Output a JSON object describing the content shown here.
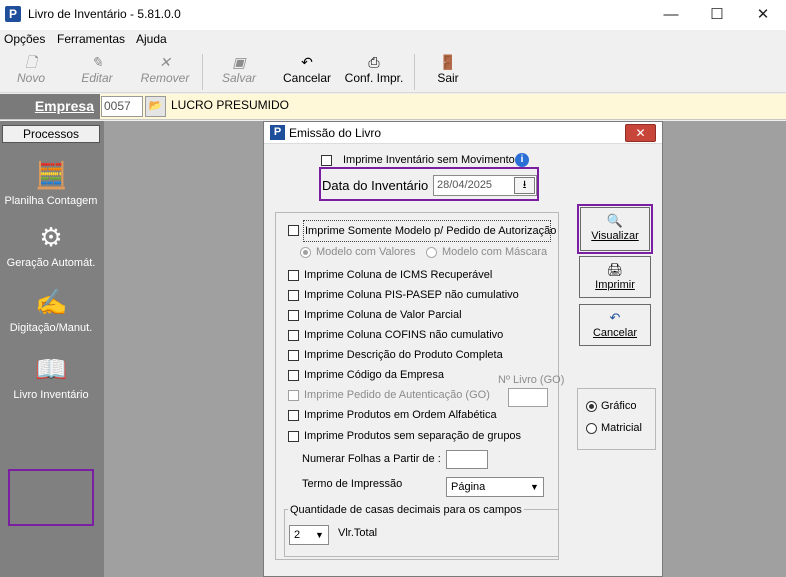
{
  "window": {
    "title": "Livro de Inventário - 5.81.0.0",
    "app_icon": "P",
    "minimize": "—",
    "maximize": "☐",
    "close": "✕"
  },
  "menu": [
    "Opções",
    "Ferramentas",
    "Ajuda"
  ],
  "toolbar": {
    "novo": "Novo",
    "editar": "Editar",
    "remover": "Remover",
    "salvar": "Salvar",
    "cancelar": "Cancelar",
    "conf_impr": "Conf. Impr.",
    "sair": "Sair"
  },
  "empresa": {
    "label": "Empresa",
    "code": "0057",
    "name": "LUCRO PRESUMIDO"
  },
  "processos": {
    "header": "Processos",
    "items": [
      "Planilha Contagem",
      "Geração Automát.",
      "Digitação/Manut.",
      "Livro Inventário"
    ]
  },
  "dialog": {
    "title": "Emissão do Livro",
    "icon": "P",
    "close": "✕",
    "sem_movimento": "Imprime Inventário sem Movimento",
    "data_label": "Data do Inventário",
    "data_value": "28/04/2025",
    "modelo_pedido": "Imprime Somente Modelo p/ Pedido de Autorização",
    "modelo_valores": "Modelo com Valores",
    "modelo_mascara": "Modelo com Máscara",
    "options": [
      "Imprime Coluna de ICMS Recuperável",
      "Imprime Coluna PIS-PASEP não cumulativo",
      "Imprime Coluna de Valor Parcial",
      "Imprime Coluna COFINS não cumulativo",
      "Imprime Descrição do Produto Completa",
      "Imprime Código da Empresa",
      "Imprime Pedido de Autenticação (GO)",
      "Imprime Produtos em Ordem Alfabética",
      "Imprime Produtos sem separação de grupos"
    ],
    "n_livro_label": "Nº Livro (GO)",
    "numerar_label": "Numerar Folhas a Partir de :",
    "termo_label": "Termo de Impressão",
    "termo_value": "Página",
    "decimais_group": "Quantidade de casas decimais para os campos",
    "decimais_value": "2",
    "vlr_total": "Vlr.Total",
    "visualizar": "Visualizar",
    "imprimir": "Imprimir",
    "cancelar": "Cancelar",
    "grafico": "Gráfico",
    "matricial": "Matricial"
  }
}
